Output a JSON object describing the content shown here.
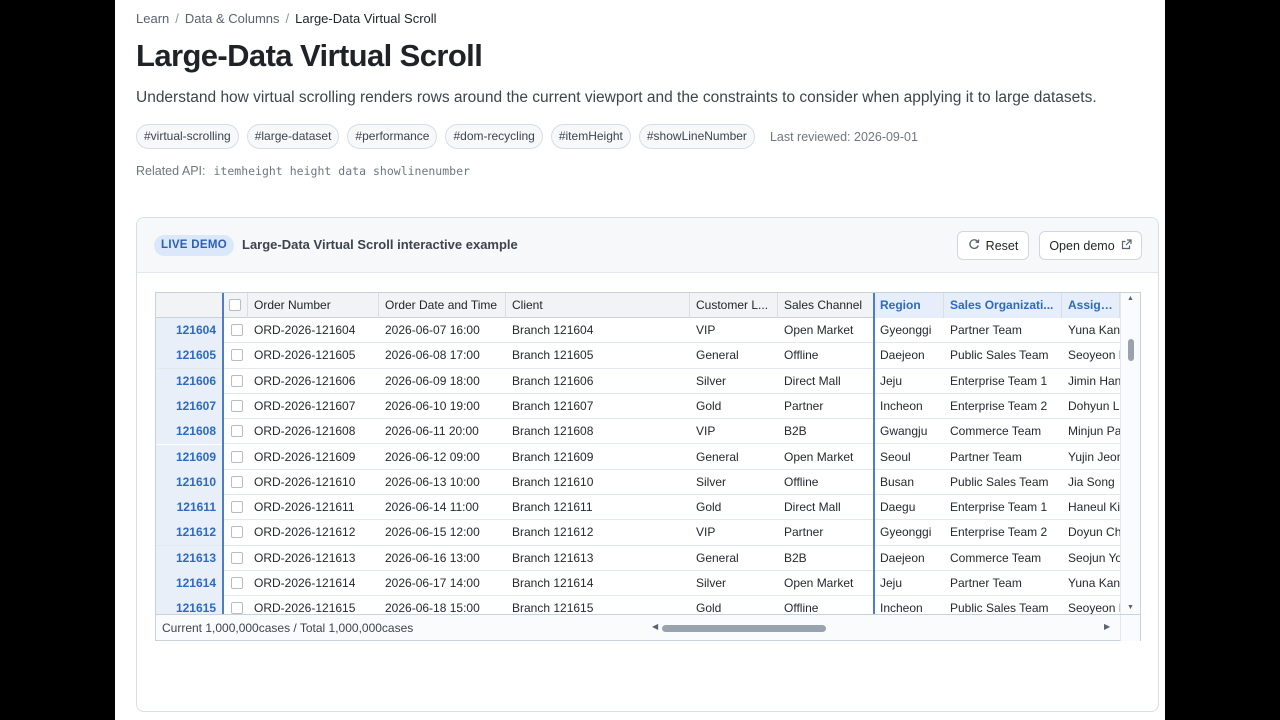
{
  "breadcrumb": {
    "items": [
      "Learn",
      "Data & Columns"
    ],
    "current": "Large-Data Virtual Scroll",
    "separator": "/"
  },
  "page": {
    "title": "Large-Data Virtual Scroll",
    "description": "Understand how virtual scrolling renders rows around the current viewport and the constraints to consider when applying it to large datasets.",
    "tags": [
      "#virtual-scrolling",
      "#large-dataset",
      "#performance",
      "#dom-recycling",
      "#itemHeight",
      "#showLineNumber"
    ],
    "last_reviewed": "Last reviewed: 2026-09-01",
    "related_api_label": "Related API:",
    "related_api": [
      "itemheight",
      "height",
      "data",
      "showlinenumber"
    ]
  },
  "demo": {
    "badge": "LIVE DEMO",
    "title": "Large-Data Virtual Scroll interactive example",
    "reset_label": "Reset",
    "open_label": "Open demo",
    "icons": {
      "reset": "refresh-icon",
      "open": "external-link-icon"
    }
  },
  "grid": {
    "columns": [
      "Order Number",
      "Order Date and Time",
      "Client",
      "Customer L...",
      "Sales Channel",
      "Region",
      "Sales Organizati...",
      "Assignee"
    ],
    "highlighted_columns": [
      "Region",
      "Sales Organizati...",
      "Assignee"
    ],
    "rows": [
      {
        "n": "121604",
        "order": "ORD-2026-121604",
        "date": "2026-06-07 16:00",
        "client": "Branch 121604",
        "level": "VIP",
        "channel": "Open Market",
        "region": "Gyeonggi",
        "org": "Partner Team",
        "assignee": "Yuna Kang"
      },
      {
        "n": "121605",
        "order": "ORD-2026-121605",
        "date": "2026-06-08 17:00",
        "client": "Branch 121605",
        "level": "General",
        "channel": "Offline",
        "region": "Daejeon",
        "org": "Public Sales Team",
        "assignee": "Seoyeon Lee"
      },
      {
        "n": "121606",
        "order": "ORD-2026-121606",
        "date": "2026-06-09 18:00",
        "client": "Branch 121606",
        "level": "Silver",
        "channel": "Direct Mall",
        "region": "Jeju",
        "org": "Enterprise Team 1",
        "assignee": "Jimin Han"
      },
      {
        "n": "121607",
        "order": "ORD-2026-121607",
        "date": "2026-06-10 19:00",
        "client": "Branch 121607",
        "level": "Gold",
        "channel": "Partner",
        "region": "Incheon",
        "org": "Enterprise Team 2",
        "assignee": "Dohyun Lim"
      },
      {
        "n": "121608",
        "order": "ORD-2026-121608",
        "date": "2026-06-11 20:00",
        "client": "Branch 121608",
        "level": "VIP",
        "channel": "B2B",
        "region": "Gwangju",
        "org": "Commerce Team",
        "assignee": "Minjun Park"
      },
      {
        "n": "121609",
        "order": "ORD-2026-121609",
        "date": "2026-06-12 09:00",
        "client": "Branch 121609",
        "level": "General",
        "channel": "Open Market",
        "region": "Seoul",
        "org": "Partner Team",
        "assignee": "Yujin Jeon"
      },
      {
        "n": "121610",
        "order": "ORD-2026-121610",
        "date": "2026-06-13 10:00",
        "client": "Branch 121610",
        "level": "Silver",
        "channel": "Offline",
        "region": "Busan",
        "org": "Public Sales Team",
        "assignee": "Jia Song"
      },
      {
        "n": "121611",
        "order": "ORD-2026-121611",
        "date": "2026-06-14 11:00",
        "client": "Branch 121611",
        "level": "Gold",
        "channel": "Direct Mall",
        "region": "Daegu",
        "org": "Enterprise Team 1",
        "assignee": "Haneul Kim"
      },
      {
        "n": "121612",
        "order": "ORD-2026-121612",
        "date": "2026-06-15 12:00",
        "client": "Branch 121612",
        "level": "VIP",
        "channel": "Partner",
        "region": "Gyeonggi",
        "org": "Enterprise Team 2",
        "assignee": "Doyun Choi"
      },
      {
        "n": "121613",
        "order": "ORD-2026-121613",
        "date": "2026-06-16 13:00",
        "client": "Branch 121613",
        "level": "General",
        "channel": "B2B",
        "region": "Daejeon",
        "org": "Commerce Team",
        "assignee": "Seojun Yoon"
      },
      {
        "n": "121614",
        "order": "ORD-2026-121614",
        "date": "2026-06-17 14:00",
        "client": "Branch 121614",
        "level": "Silver",
        "channel": "Open Market",
        "region": "Jeju",
        "org": "Partner Team",
        "assignee": "Yuna Kang"
      },
      {
        "n": "121615",
        "order": "ORD-2026-121615",
        "date": "2026-06-18 15:00",
        "client": "Branch 121615",
        "level": "Gold",
        "channel": "Offline",
        "region": "Incheon",
        "org": "Public Sales Team",
        "assignee": "Seoyeon Lee"
      }
    ],
    "footer_count": "Current 1,000,000cases / Total 1,000,000cases"
  },
  "colors": {
    "accent": "#2c6ac4",
    "frozen_divider": "#4b7ec6",
    "badge_bg": "#dbe7fb"
  }
}
